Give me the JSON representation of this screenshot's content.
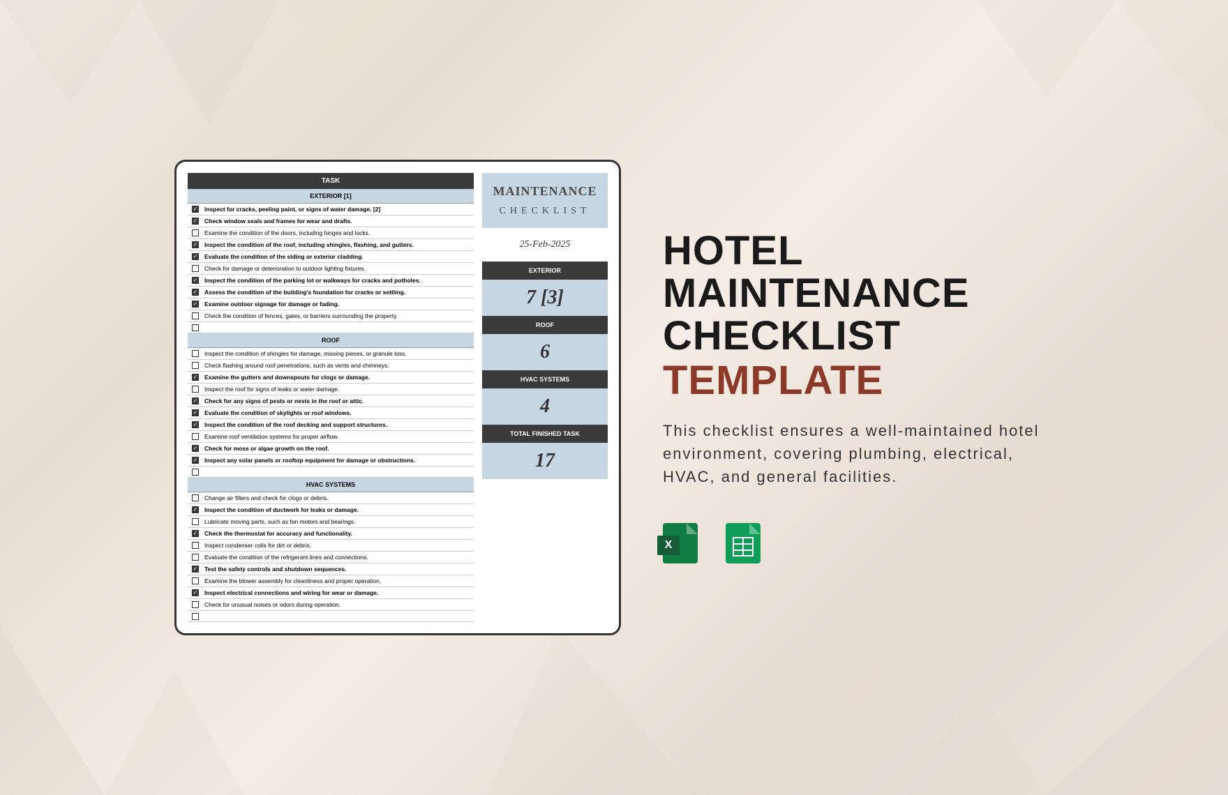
{
  "card": {
    "taskHeader": "TASK",
    "sections": [
      {
        "name": "EXTERIOR [1]",
        "tasks": [
          {
            "checked": true,
            "bold": true,
            "text": "Inspect for cracks, peeling paint, or signs of water damage. [2]"
          },
          {
            "checked": true,
            "bold": true,
            "text": "Check window seals and frames for wear and drafts."
          },
          {
            "checked": false,
            "bold": false,
            "text": "Examine the condition of the doors, including hinges and locks."
          },
          {
            "checked": true,
            "bold": true,
            "text": "Inspect the condition of the roof, including shingles, flashing, and gutters."
          },
          {
            "checked": true,
            "bold": true,
            "text": "Evaluate the condition of the siding or exterior cladding."
          },
          {
            "checked": false,
            "bold": false,
            "text": "Check for damage or deterioration to outdoor lighting fixtures."
          },
          {
            "checked": true,
            "bold": true,
            "text": "Inspect the condition of the parking lot or walkways for cracks and potholes."
          },
          {
            "checked": true,
            "bold": true,
            "text": "Assess the condition of the building's foundation for cracks or settling."
          },
          {
            "checked": true,
            "bold": true,
            "text": "Examine outdoor signage for damage or fading."
          },
          {
            "checked": false,
            "bold": false,
            "text": "Check the condition of fences, gates, or barriers surrounding the property."
          },
          {
            "checked": false,
            "bold": false,
            "text": "",
            "empty": true
          }
        ]
      },
      {
        "name": "ROOF",
        "tasks": [
          {
            "checked": false,
            "bold": false,
            "text": "Inspect the condition of shingles for damage, missing pieces, or granule loss."
          },
          {
            "checked": false,
            "bold": false,
            "text": "Check flashing around roof penetrations, such as vents and chimneys."
          },
          {
            "checked": true,
            "bold": true,
            "text": "Examine the gutters and downspouts for clogs or damage."
          },
          {
            "checked": false,
            "bold": false,
            "text": "Inspect the roof for signs of leaks or water damage."
          },
          {
            "checked": true,
            "bold": true,
            "text": "Check for any signs of pests or nests in the roof or attic."
          },
          {
            "checked": true,
            "bold": true,
            "text": "Evaluate the condition of skylights or roof windows."
          },
          {
            "checked": true,
            "bold": true,
            "text": "Inspect the condition of the roof decking and support structures."
          },
          {
            "checked": false,
            "bold": false,
            "text": "Examine roof ventilation systems for proper airflow."
          },
          {
            "checked": true,
            "bold": true,
            "text": "Check for moss or algae growth on the roof."
          },
          {
            "checked": true,
            "bold": true,
            "text": "Inspect any solar panels or rooftop equipment for damage or obstructions."
          },
          {
            "checked": false,
            "bold": false,
            "text": "",
            "empty": true
          }
        ]
      },
      {
        "name": "HVAC SYSTEMS",
        "tasks": [
          {
            "checked": false,
            "bold": false,
            "text": "Change air filters and check for clogs or debris."
          },
          {
            "checked": true,
            "bold": true,
            "text": "Inspect the condition of ductwork for leaks or damage."
          },
          {
            "checked": false,
            "bold": false,
            "text": "Lubricate moving parts, such as fan motors and bearings."
          },
          {
            "checked": true,
            "bold": true,
            "text": "Check the thermostat for accuracy and functionality."
          },
          {
            "checked": false,
            "bold": false,
            "text": "Inspect condenser coils for dirt or debris."
          },
          {
            "checked": false,
            "bold": false,
            "text": "Evaluate the condition of the refrigerant lines and connections."
          },
          {
            "checked": true,
            "bold": true,
            "text": "Test the safety controls and shutdown sequences."
          },
          {
            "checked": false,
            "bold": false,
            "text": "Examine the blower assembly for cleanliness and proper operation."
          },
          {
            "checked": true,
            "bold": true,
            "text": "Inspect electrical connections and wiring for wear or damage."
          },
          {
            "checked": false,
            "bold": false,
            "text": "Check for unusual noises or odors during operation."
          },
          {
            "checked": false,
            "bold": false,
            "text": "",
            "empty": true
          }
        ]
      }
    ],
    "sidebar": {
      "title1": "MAINTENANCE",
      "title2": "CHECKLIST",
      "date": "25-Feb-2025",
      "stats": [
        {
          "label": "EXTERIOR",
          "value": "7 [3]"
        },
        {
          "label": "ROOF",
          "value": "6"
        },
        {
          "label": "HVAC SYSTEMS",
          "value": "4"
        },
        {
          "label": "TOTAL FINISHED TASK",
          "value": "17"
        }
      ]
    }
  },
  "panel": {
    "titleLine1": "HOTEL",
    "titleLine2": "MAINTENANCE",
    "titleLine3": "CHECKLIST",
    "templateWord": "TEMPLATE",
    "description": "This checklist ensures a well-maintained hotel environment, covering plumbing, electrical, HVAC, and general facilities."
  }
}
